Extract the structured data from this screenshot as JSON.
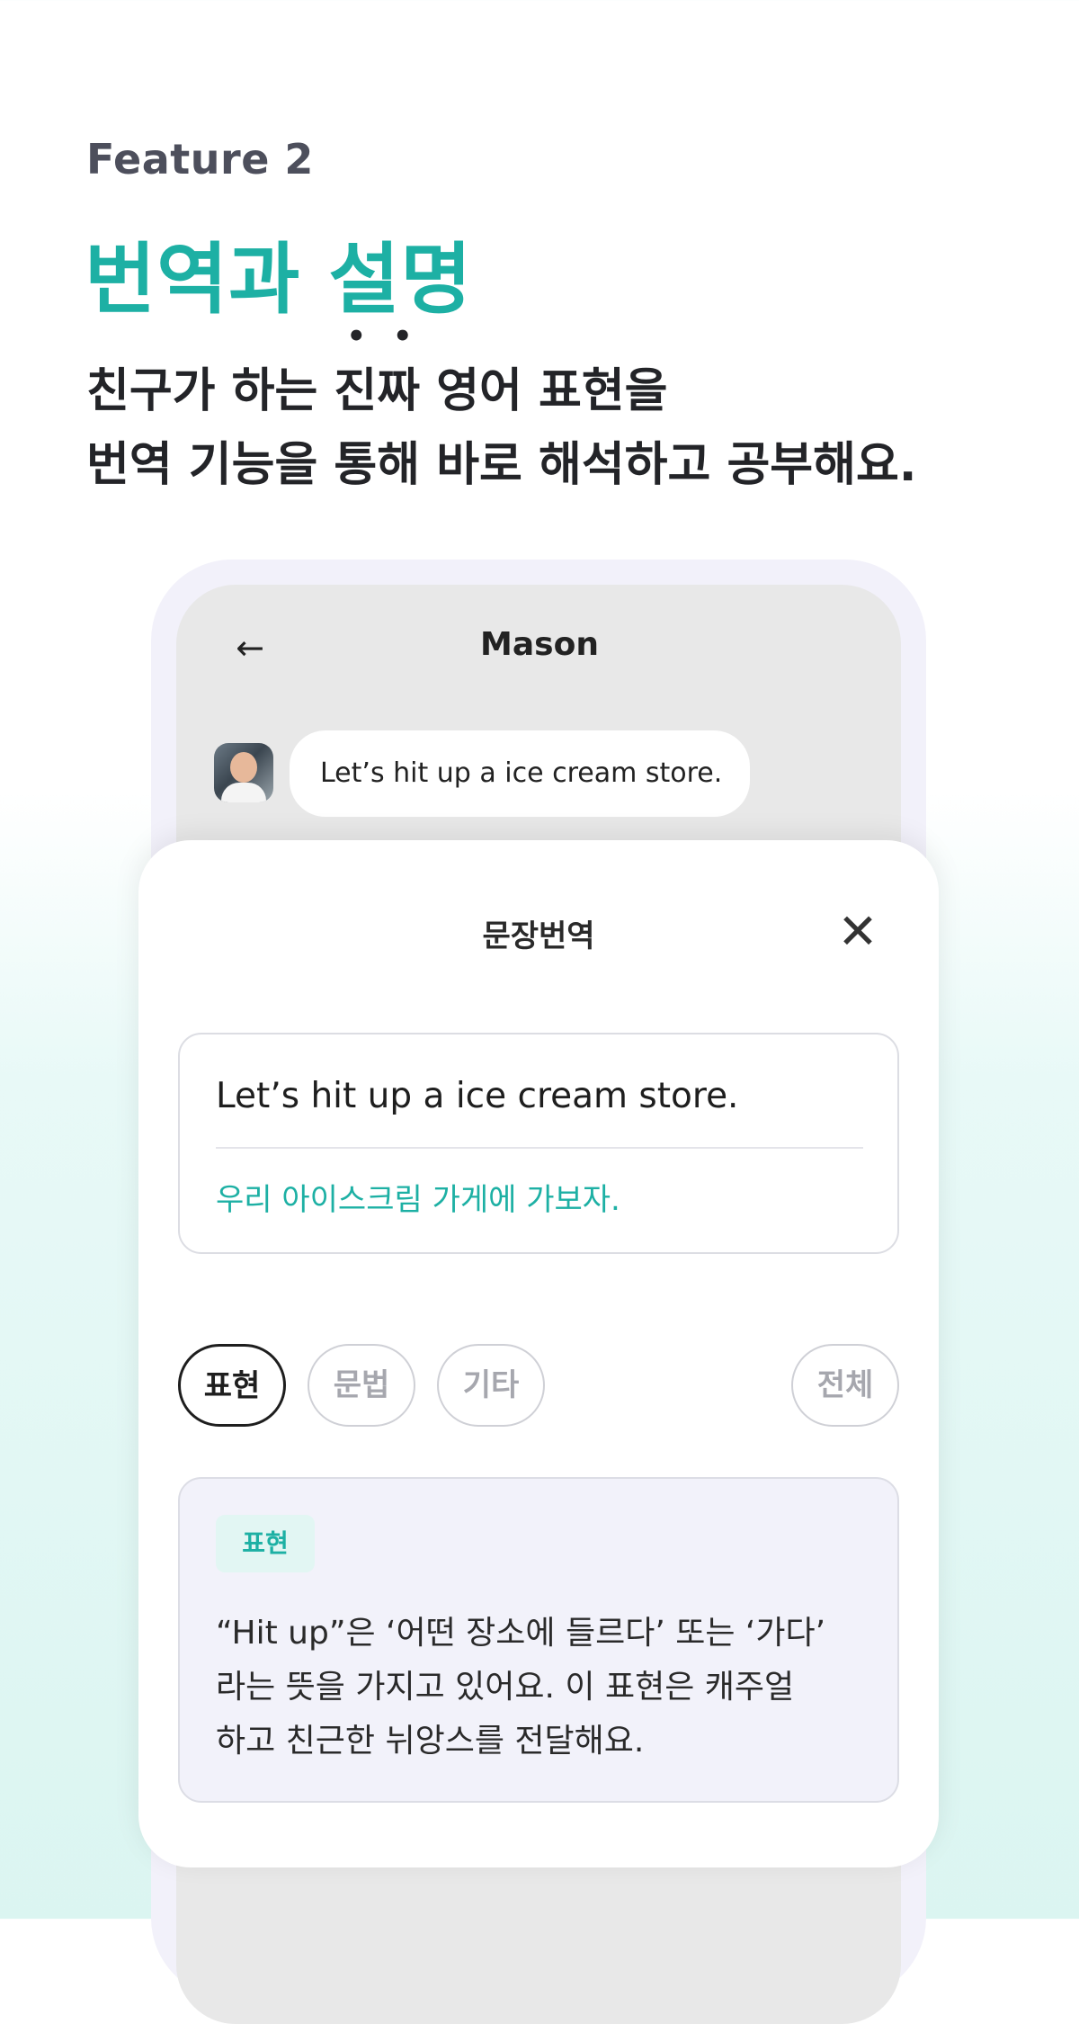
{
  "header": {
    "feature_label": "Feature 2",
    "headline": "번역과 설명",
    "subline_1_before": "친구가 하는 ",
    "subline_1_emphasis": "진짜",
    "subline_1_after": " 영어 표현을",
    "subline_2": "번역 기능을 통해 바로 해석하고 공부해요."
  },
  "chat": {
    "back_icon": "arrow-left-icon",
    "title": "Mason",
    "message": "Let’s hit up a ice cream store."
  },
  "sheet": {
    "title": "문장번역",
    "close_icon": "close-icon",
    "translation": {
      "english": "Let’s hit up a ice cream store.",
      "korean": "우리 아이스크림 가게에 가보자."
    },
    "chips": [
      {
        "label": "표현",
        "active": true
      },
      {
        "label": "문법",
        "active": false
      },
      {
        "label": "기타",
        "active": false
      },
      {
        "label": "전체",
        "active": false
      }
    ],
    "explanation": {
      "tag": "표현",
      "lines": [
        "“Hit up”은 ‘어떤 장소에 들르다’ 또는 ‘가다’",
        "라는 뜻을 가지고 있어요. 이 표현은 캐주얼",
        "하고 친근한 뉘앙스를 전달해요."
      ]
    }
  },
  "colors": {
    "accent": "#1db0a4",
    "text_dark": "#232428",
    "phone_screen": "#e8e8e8",
    "explanation_bg": "#f2f2fa"
  }
}
